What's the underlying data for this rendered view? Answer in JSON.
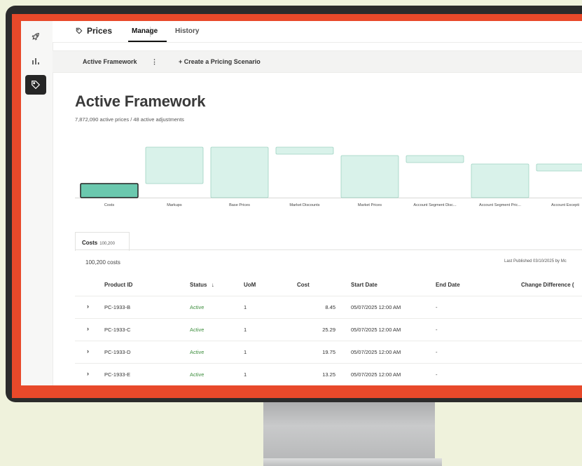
{
  "colors": {
    "background": "#eff2dc",
    "frame": "#e8492a",
    "bar_fill": "#d9f2ea",
    "bar_stroke": "#9fd3c2",
    "bar_active_fill": "#6bc8ae",
    "bar_active_stroke": "#222222",
    "status_active": "#3f8f3f"
  },
  "rail": {
    "items": [
      {
        "icon": "rocket-icon"
      },
      {
        "icon": "bar-chart-icon"
      },
      {
        "icon": "tag-icon"
      }
    ]
  },
  "topnav": {
    "title": "Prices",
    "tabs": [
      {
        "label": "Manage"
      },
      {
        "label": "History"
      }
    ]
  },
  "subbar": {
    "framework_label": "Active Framework",
    "kebab": "⋮",
    "create_label": "+ Create a Pricing Scenario"
  },
  "page": {
    "title": "Active Framework",
    "counts": "7,872,090 active prices  /  48 active adjustments"
  },
  "chart_data": {
    "type": "bar",
    "categories": [
      "Costs",
      "Markups",
      "Base Prices",
      "Market Discounts",
      "Market Prices",
      "Account Segment Disc...",
      "Account Segment Pric...",
      "Account Excepti"
    ],
    "bars": [
      {
        "low": 0,
        "high": 20
      },
      {
        "low": 20,
        "high": 72
      },
      {
        "low": 0,
        "high": 72
      },
      {
        "low": 62,
        "high": 72
      },
      {
        "low": 0,
        "high": 60
      },
      {
        "low": 50,
        "high": 60
      },
      {
        "low": 0,
        "high": 48
      },
      {
        "low": 38,
        "high": 48
      }
    ],
    "active_index": 0,
    "ylim": [
      0,
      80
    ],
    "grid": false
  },
  "tabs": {
    "costs": {
      "label": "Costs",
      "count": "100,200"
    }
  },
  "table": {
    "count_text": "100,200 costs",
    "published": "Last Published 03/10/2025 by Mc",
    "headers": {
      "product_id": "Product ID",
      "status": "Status",
      "sort_arrow": "↓",
      "uom": "UoM",
      "cost": "Cost",
      "start_date": "Start Date",
      "end_date": "End Date",
      "change": "Change Difference ("
    },
    "rows": [
      {
        "expand": "›",
        "product_id": "PC-1933-B",
        "status": "Active",
        "uom": "1",
        "cost": "8.45",
        "start": "05/07/2025 12:00 AM",
        "end": "-"
      },
      {
        "expand": "›",
        "product_id": "PC-1933-C",
        "status": "Active",
        "uom": "1",
        "cost": "25.29",
        "start": "05/07/2025 12:00 AM",
        "end": "-"
      },
      {
        "expand": "›",
        "product_id": "PC-1933-D",
        "status": "Active",
        "uom": "1",
        "cost": "19.75",
        "start": "05/07/2025 12:00 AM",
        "end": "-"
      },
      {
        "expand": "›",
        "product_id": "PC-1933-E",
        "status": "Active",
        "uom": "1",
        "cost": "13.25",
        "start": "05/07/2025 12:00 AM",
        "end": "-"
      }
    ]
  }
}
